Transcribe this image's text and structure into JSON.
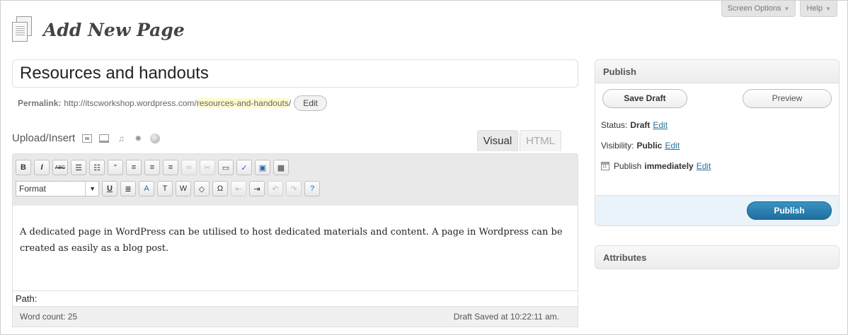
{
  "header": {
    "title": "Add New Page",
    "screen_options_label": "Screen Options",
    "help_label": "Help"
  },
  "post": {
    "title": "Resources and handouts",
    "permalink_label": "Permalink:",
    "permalink_base": "http://itscworkshop.wordpress.com/",
    "permalink_slug": "resources-and-handouts",
    "permalink_trail": "/",
    "permalink_edit_label": "Edit"
  },
  "editor": {
    "upload_insert_label": "Upload/Insert",
    "media_icons": [
      "image-icon",
      "video-icon",
      "audio-icon",
      "media-icon",
      "circle-icon"
    ],
    "tabs": [
      {
        "label": "Visual",
        "active": true
      },
      {
        "label": "HTML",
        "active": false
      }
    ],
    "toolbar_row1": [
      {
        "name": "bold-button",
        "glyph": "B"
      },
      {
        "name": "italic-button",
        "glyph": "I"
      },
      {
        "name": "strikethrough-button",
        "glyph": "ABC"
      },
      {
        "name": "bullet-list-button",
        "glyph": "☰"
      },
      {
        "name": "numbered-list-button",
        "glyph": "☷"
      },
      {
        "name": "blockquote-button",
        "glyph": "“"
      },
      {
        "name": "align-left-button",
        "glyph": "≡"
      },
      {
        "name": "align-center-button",
        "glyph": "≡"
      },
      {
        "name": "align-right-button",
        "glyph": "≡"
      },
      {
        "name": "link-button",
        "glyph": "∞"
      },
      {
        "name": "unlink-button",
        "glyph": "✂"
      },
      {
        "name": "more-button",
        "glyph": "▭"
      },
      {
        "name": "spellcheck-button",
        "glyph": "✓"
      },
      {
        "name": "fullscreen-button",
        "glyph": "▣"
      },
      {
        "name": "kitchen-sink-button",
        "glyph": "▦"
      }
    ],
    "format_label": "Format",
    "toolbar_row2": [
      {
        "name": "underline-button",
        "glyph": "U"
      },
      {
        "name": "justify-button",
        "glyph": "≣"
      },
      {
        "name": "text-color-button",
        "glyph": "A"
      },
      {
        "name": "paste-text-button",
        "glyph": "T"
      },
      {
        "name": "paste-word-button",
        "glyph": "W"
      },
      {
        "name": "remove-format-button",
        "glyph": "◇"
      },
      {
        "name": "special-char-button",
        "glyph": "Ω"
      },
      {
        "name": "outdent-button",
        "glyph": "⇤"
      },
      {
        "name": "indent-button",
        "glyph": "⇥"
      },
      {
        "name": "undo-button",
        "glyph": "↶"
      },
      {
        "name": "redo-button",
        "glyph": "↷"
      },
      {
        "name": "help-button",
        "glyph": "?"
      }
    ],
    "content": "A dedicated page in WordPress can be utilised to host dedicated materials and content. A page in Wordpress can be created as easily as a blog post.",
    "path_label": "Path:",
    "word_count": "Word count: 25",
    "draft_saved": "Draft Saved at 10:22:11 am."
  },
  "publish_box": {
    "title": "Publish",
    "save_draft_label": "Save Draft",
    "preview_label": "Preview",
    "status_label": "Status:",
    "status_value": "Draft",
    "visibility_label": "Visibility:",
    "visibility_value": "Public",
    "publish_label": "Publish",
    "publish_when": "immediately",
    "edit_label": "Edit",
    "publish_button_label": "Publish"
  },
  "attributes_box": {
    "title": "Attributes"
  },
  "colors": {
    "link": "#21759b",
    "publish_button": "#2a7fb0",
    "slug_highlight": "#fffbcc"
  }
}
